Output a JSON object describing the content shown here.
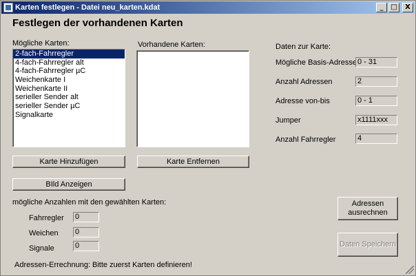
{
  "window": {
    "title": "Karten festlegen - Datei neu_karten.kdat",
    "minimize": "_",
    "maximize": "□",
    "close": "X"
  },
  "heading": "Festlegen der vorhandenen Karten",
  "possible": {
    "label": "Mögliche Karten:",
    "items": [
      "2-fach-Fahrregler",
      "4-fach-Fahrregler alt",
      "4-fach-Fahrregler µC",
      "Weichenkarte I",
      "Weichenkarte II",
      "serieller Sender alt",
      "serieller Sender µC",
      "Signalkarte"
    ],
    "selected_index": 0
  },
  "existing": {
    "label": "Vorhandene Karten:",
    "items": []
  },
  "buttons": {
    "add": "Karte Hinzufügen",
    "remove": "Karte Entfernen",
    "show_image": "BIld Anzeigen",
    "calc": "Adressen ausrechnen",
    "save": "Daten Speichern"
  },
  "card_data": {
    "label": "Daten zur Karte:",
    "fields": [
      {
        "label": "Mögliche Basis-Adressen",
        "value": "0 - 31"
      },
      {
        "label": "Anzahl Adressen",
        "value": "2"
      },
      {
        "label": "Adresse von-bis",
        "value": "0 - 1"
      },
      {
        "label": "Jumper",
        "value": "x1111xxx"
      },
      {
        "label": "Anzahl Fahrregler",
        "value": "4"
      }
    ]
  },
  "counts": {
    "label": "mögliche Anzahlen mit den gewählten Karten:",
    "fields": [
      {
        "label": "Fahrregler",
        "value": "0"
      },
      {
        "label": "Weichen",
        "value": "0"
      },
      {
        "label": "Signale",
        "value": "0"
      }
    ]
  },
  "status": {
    "label": "Adressen-Errechnung:",
    "message": "Bitte zuerst Karten definieren!"
  }
}
